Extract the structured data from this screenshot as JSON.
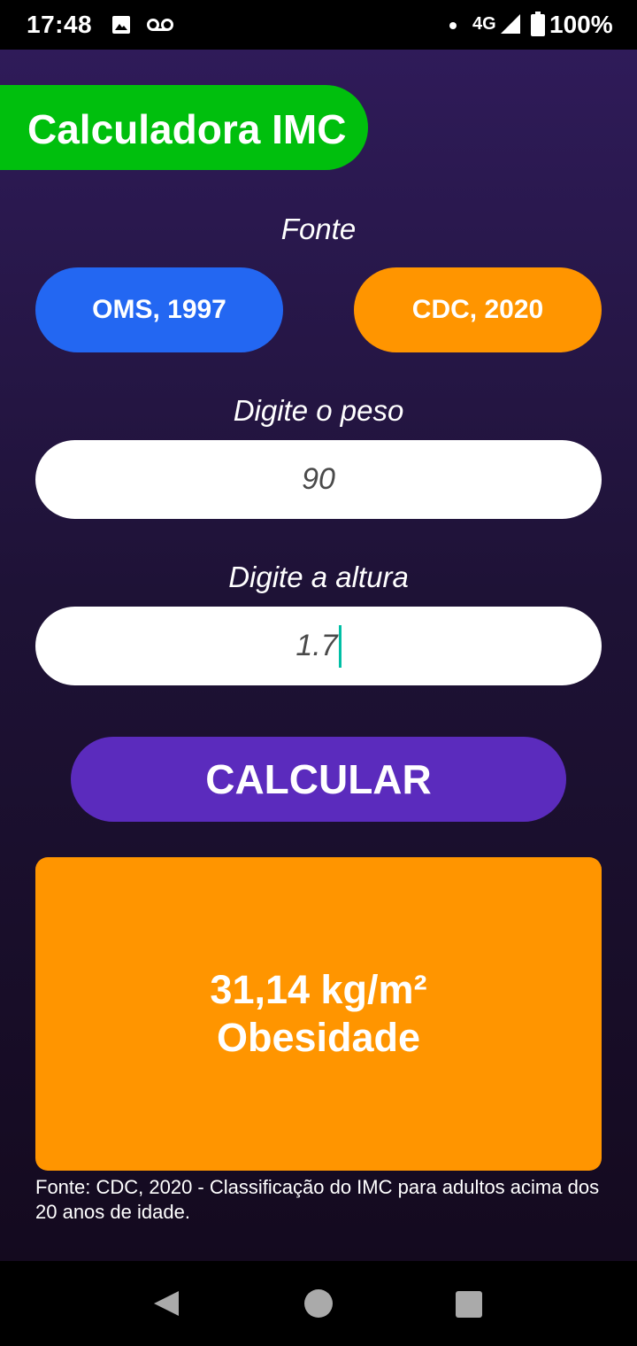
{
  "status_bar": {
    "time": "17:48",
    "network": "4G",
    "battery": "100%",
    "icons": [
      "image-icon",
      "voicemail-icon",
      "notification-dot",
      "signal-icon",
      "battery-icon"
    ]
  },
  "app": {
    "title": "Calculadora IMC",
    "source_label": "Fonte",
    "sources": [
      {
        "label": "OMS, 1997",
        "color": "#2367f2"
      },
      {
        "label": "CDC, 2020",
        "color": "#ff9500"
      }
    ],
    "weight": {
      "label": "Digite o peso",
      "value": "90"
    },
    "height": {
      "label": "Digite a altura",
      "value": "1.7"
    },
    "calculate_label": "CALCULAR",
    "result": {
      "value": "31,14 kg/m²",
      "classification": "Obesidade",
      "color": "#ff9500"
    },
    "footnote": "Fonte: CDC, 2020 - Classificação do IMC para adultos acima dos 20 anos de idade."
  },
  "colors": {
    "title_bg": "#00bf0d",
    "calculate_bg": "#5b2bbd",
    "background_top": "#2f1b59",
    "background_bottom": "#140a1f"
  },
  "nav_bar": {
    "icons": [
      "back-icon",
      "home-icon",
      "recents-icon"
    ]
  }
}
